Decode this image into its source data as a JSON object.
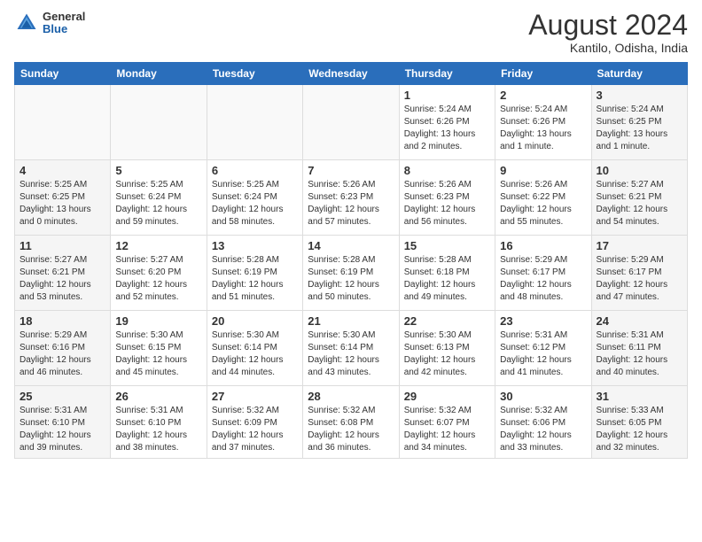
{
  "header": {
    "logo_general": "General",
    "logo_blue": "Blue",
    "month_title": "August 2024",
    "location": "Kantilo, Odisha, India"
  },
  "weekdays": [
    "Sunday",
    "Monday",
    "Tuesday",
    "Wednesday",
    "Thursday",
    "Friday",
    "Saturday"
  ],
  "weeks": [
    [
      {
        "day": "",
        "info": "",
        "empty": true
      },
      {
        "day": "",
        "info": "",
        "empty": true
      },
      {
        "day": "",
        "info": "",
        "empty": true
      },
      {
        "day": "",
        "info": "",
        "empty": true
      },
      {
        "day": "1",
        "info": "Sunrise: 5:24 AM\nSunset: 6:26 PM\nDaylight: 13 hours\nand 2 minutes."
      },
      {
        "day": "2",
        "info": "Sunrise: 5:24 AM\nSunset: 6:26 PM\nDaylight: 13 hours\nand 1 minute."
      },
      {
        "day": "3",
        "info": "Sunrise: 5:24 AM\nSunset: 6:25 PM\nDaylight: 13 hours\nand 1 minute.",
        "weekend": true
      }
    ],
    [
      {
        "day": "4",
        "info": "Sunrise: 5:25 AM\nSunset: 6:25 PM\nDaylight: 13 hours\nand 0 minutes.",
        "weekend": true
      },
      {
        "day": "5",
        "info": "Sunrise: 5:25 AM\nSunset: 6:24 PM\nDaylight: 12 hours\nand 59 minutes."
      },
      {
        "day": "6",
        "info": "Sunrise: 5:25 AM\nSunset: 6:24 PM\nDaylight: 12 hours\nand 58 minutes."
      },
      {
        "day": "7",
        "info": "Sunrise: 5:26 AM\nSunset: 6:23 PM\nDaylight: 12 hours\nand 57 minutes."
      },
      {
        "day": "8",
        "info": "Sunrise: 5:26 AM\nSunset: 6:23 PM\nDaylight: 12 hours\nand 56 minutes."
      },
      {
        "day": "9",
        "info": "Sunrise: 5:26 AM\nSunset: 6:22 PM\nDaylight: 12 hours\nand 55 minutes."
      },
      {
        "day": "10",
        "info": "Sunrise: 5:27 AM\nSunset: 6:21 PM\nDaylight: 12 hours\nand 54 minutes.",
        "weekend": true
      }
    ],
    [
      {
        "day": "11",
        "info": "Sunrise: 5:27 AM\nSunset: 6:21 PM\nDaylight: 12 hours\nand 53 minutes.",
        "weekend": true
      },
      {
        "day": "12",
        "info": "Sunrise: 5:27 AM\nSunset: 6:20 PM\nDaylight: 12 hours\nand 52 minutes."
      },
      {
        "day": "13",
        "info": "Sunrise: 5:28 AM\nSunset: 6:19 PM\nDaylight: 12 hours\nand 51 minutes."
      },
      {
        "day": "14",
        "info": "Sunrise: 5:28 AM\nSunset: 6:19 PM\nDaylight: 12 hours\nand 50 minutes."
      },
      {
        "day": "15",
        "info": "Sunrise: 5:28 AM\nSunset: 6:18 PM\nDaylight: 12 hours\nand 49 minutes."
      },
      {
        "day": "16",
        "info": "Sunrise: 5:29 AM\nSunset: 6:17 PM\nDaylight: 12 hours\nand 48 minutes."
      },
      {
        "day": "17",
        "info": "Sunrise: 5:29 AM\nSunset: 6:17 PM\nDaylight: 12 hours\nand 47 minutes.",
        "weekend": true
      }
    ],
    [
      {
        "day": "18",
        "info": "Sunrise: 5:29 AM\nSunset: 6:16 PM\nDaylight: 12 hours\nand 46 minutes.",
        "weekend": true
      },
      {
        "day": "19",
        "info": "Sunrise: 5:30 AM\nSunset: 6:15 PM\nDaylight: 12 hours\nand 45 minutes."
      },
      {
        "day": "20",
        "info": "Sunrise: 5:30 AM\nSunset: 6:14 PM\nDaylight: 12 hours\nand 44 minutes."
      },
      {
        "day": "21",
        "info": "Sunrise: 5:30 AM\nSunset: 6:14 PM\nDaylight: 12 hours\nand 43 minutes."
      },
      {
        "day": "22",
        "info": "Sunrise: 5:30 AM\nSunset: 6:13 PM\nDaylight: 12 hours\nand 42 minutes."
      },
      {
        "day": "23",
        "info": "Sunrise: 5:31 AM\nSunset: 6:12 PM\nDaylight: 12 hours\nand 41 minutes."
      },
      {
        "day": "24",
        "info": "Sunrise: 5:31 AM\nSunset: 6:11 PM\nDaylight: 12 hours\nand 40 minutes.",
        "weekend": true
      }
    ],
    [
      {
        "day": "25",
        "info": "Sunrise: 5:31 AM\nSunset: 6:10 PM\nDaylight: 12 hours\nand 39 minutes.",
        "weekend": true
      },
      {
        "day": "26",
        "info": "Sunrise: 5:31 AM\nSunset: 6:10 PM\nDaylight: 12 hours\nand 38 minutes."
      },
      {
        "day": "27",
        "info": "Sunrise: 5:32 AM\nSunset: 6:09 PM\nDaylight: 12 hours\nand 37 minutes."
      },
      {
        "day": "28",
        "info": "Sunrise: 5:32 AM\nSunset: 6:08 PM\nDaylight: 12 hours\nand 36 minutes."
      },
      {
        "day": "29",
        "info": "Sunrise: 5:32 AM\nSunset: 6:07 PM\nDaylight: 12 hours\nand 34 minutes."
      },
      {
        "day": "30",
        "info": "Sunrise: 5:32 AM\nSunset: 6:06 PM\nDaylight: 12 hours\nand 33 minutes."
      },
      {
        "day": "31",
        "info": "Sunrise: 5:33 AM\nSunset: 6:05 PM\nDaylight: 12 hours\nand 32 minutes.",
        "weekend": true
      }
    ]
  ]
}
